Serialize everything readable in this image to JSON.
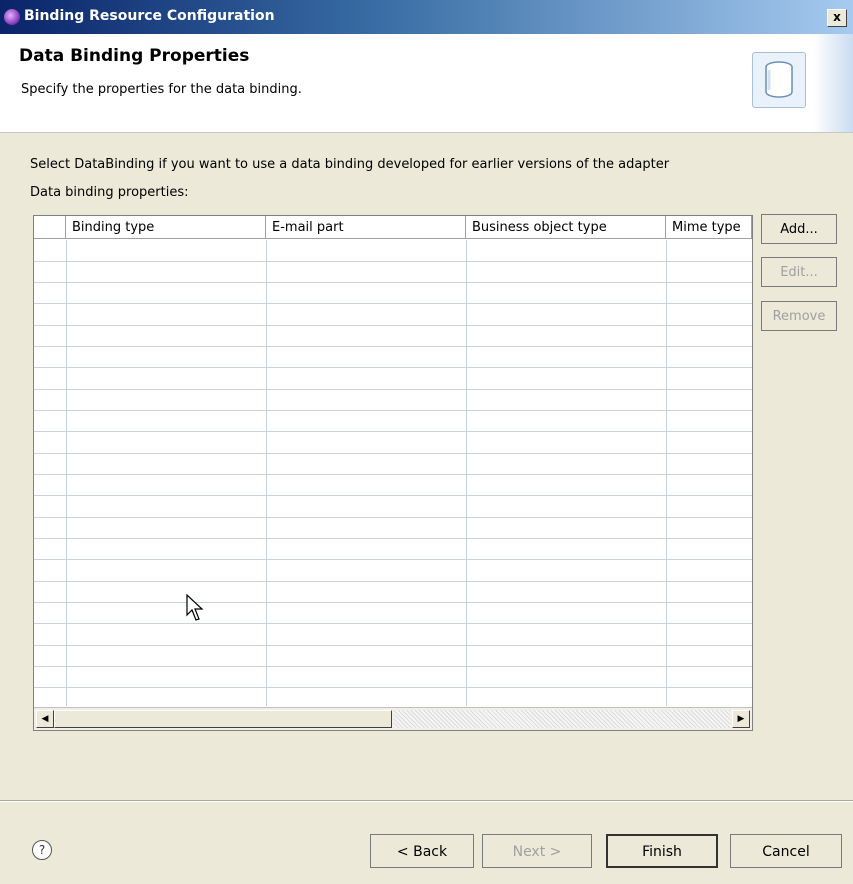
{
  "window": {
    "title": "Binding Resource Configuration",
    "close_label": "x"
  },
  "banner": {
    "title": "Data Binding Properties",
    "description": "Specify the properties for the data binding."
  },
  "content": {
    "hint": "Select DataBinding if you want to use a data binding developed for earlier versions of the adapter",
    "table_label": "Data binding properties:"
  },
  "table": {
    "columns": [
      "Binding type",
      "E-mail part",
      "Business object type",
      "Mime type"
    ],
    "rows": []
  },
  "side_buttons": {
    "add": "Add...",
    "edit": "Edit...",
    "remove": "Remove"
  },
  "footer": {
    "help": "?",
    "back": "< Back",
    "next": "Next >",
    "finish": "Finish",
    "cancel": "Cancel"
  }
}
